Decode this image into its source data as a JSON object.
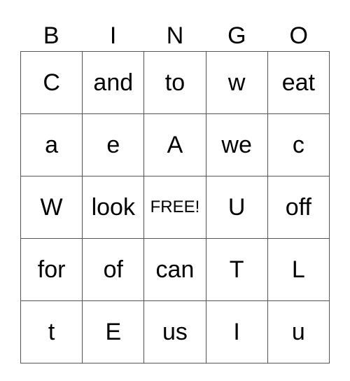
{
  "header": {
    "letters": [
      "B",
      "I",
      "N",
      "G",
      "O"
    ]
  },
  "board": {
    "rows": [
      [
        "C",
        "and",
        "to",
        "w",
        "eat"
      ],
      [
        "a",
        "e",
        "A",
        "we",
        "c"
      ],
      [
        "W",
        "look",
        "FREE!",
        "U",
        "off"
      ],
      [
        "for",
        "of",
        "can",
        "T",
        "L"
      ],
      [
        "t",
        "E",
        "us",
        "I",
        "u"
      ]
    ]
  }
}
